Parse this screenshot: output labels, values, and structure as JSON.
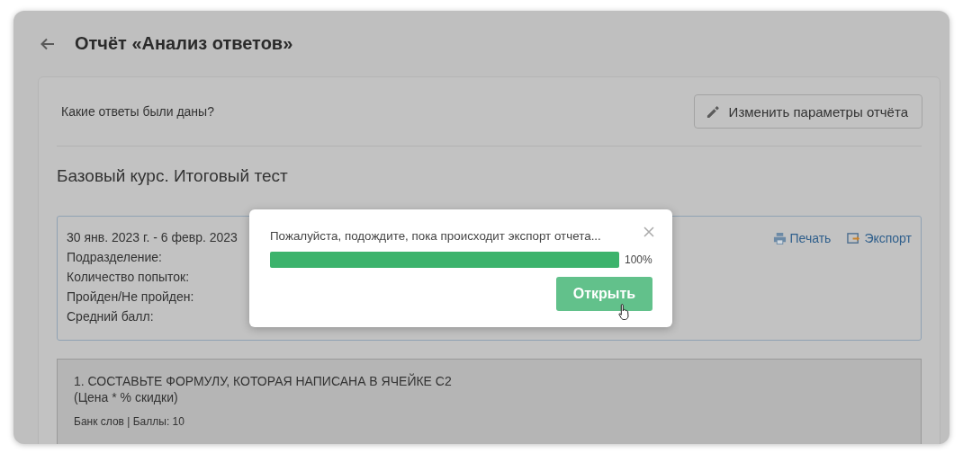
{
  "header": {
    "title": "Отчёт «Анализ ответов»"
  },
  "report": {
    "question": "Какие ответы были даны?",
    "edit_button": "Изменить параметры отчёта",
    "course_title": "Базовый курс. Итоговый тест"
  },
  "summary": {
    "period": "30 янв. 2023 г. - 6 февр. 2023",
    "labels": [
      "Подразделение:",
      "Количество попыток:",
      "Пройден/Не пройден:",
      "Средний балл:"
    ],
    "actions": [
      {
        "kind": "print",
        "label": "Печать"
      },
      {
        "kind": "export",
        "label": "Экспорт"
      }
    ]
  },
  "questions": [
    {
      "title": "1. СОСТАВЬТЕ ФОРМУЛУ, КОТОРАЯ НАПИСАНА В ЯЧЕЙКЕ С2",
      "subtitle": "(Цена * % скидки)",
      "meta": "Банк слов | Баллы: 10"
    }
  ],
  "dialog": {
    "message": "Пожалуйста, подождите, пока происходит экспорт отчета...",
    "level": 1,
    "reading": "100%",
    "button": "Открыть"
  }
}
